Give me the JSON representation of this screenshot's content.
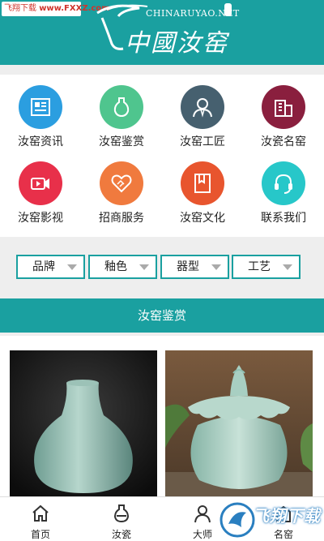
{
  "watermark_top": {
    "site": "飞翔下载",
    "url": "www.FXXZ.com"
  },
  "header": {
    "logo_en": "CHINARUYAO.NET",
    "logo_cn": "中國汝窑"
  },
  "grid": [
    {
      "label": "汝窑资讯",
      "icon": "news-icon",
      "color": "#2b9ee0"
    },
    {
      "label": "汝窑鉴赏",
      "icon": "vase-icon",
      "color": "#4fc58e"
    },
    {
      "label": "汝窑工匠",
      "icon": "craftsman-icon",
      "color": "#46606f"
    },
    {
      "label": "汝瓷名窑",
      "icon": "building-icon",
      "color": "#8a1f3e"
    },
    {
      "label": "汝窑影视",
      "icon": "video-icon",
      "color": "#e8304a"
    },
    {
      "label": "招商服务",
      "icon": "handshake-icon",
      "color": "#f07a3e"
    },
    {
      "label": "汝窑文化",
      "icon": "book-icon",
      "color": "#e8552e"
    },
    {
      "label": "联系我们",
      "icon": "headset-icon",
      "color": "#27c7c9"
    }
  ],
  "filters": [
    {
      "label": "品牌"
    },
    {
      "label": "釉色"
    },
    {
      "label": "器型"
    },
    {
      "label": "工艺"
    }
  ],
  "section_title": "汝窑鉴赏",
  "nav": [
    {
      "label": "首页",
      "icon": "home-icon"
    },
    {
      "label": "汝瓷",
      "icon": "vase-icon"
    },
    {
      "label": "大师",
      "icon": "master-icon"
    },
    {
      "label": "名窑",
      "icon": "kiln-icon"
    }
  ],
  "watermark_bottom": {
    "text": "飞翔下载"
  },
  "colors": {
    "teal": "#1aa0a0",
    "celadon": "#8fc1b5"
  }
}
